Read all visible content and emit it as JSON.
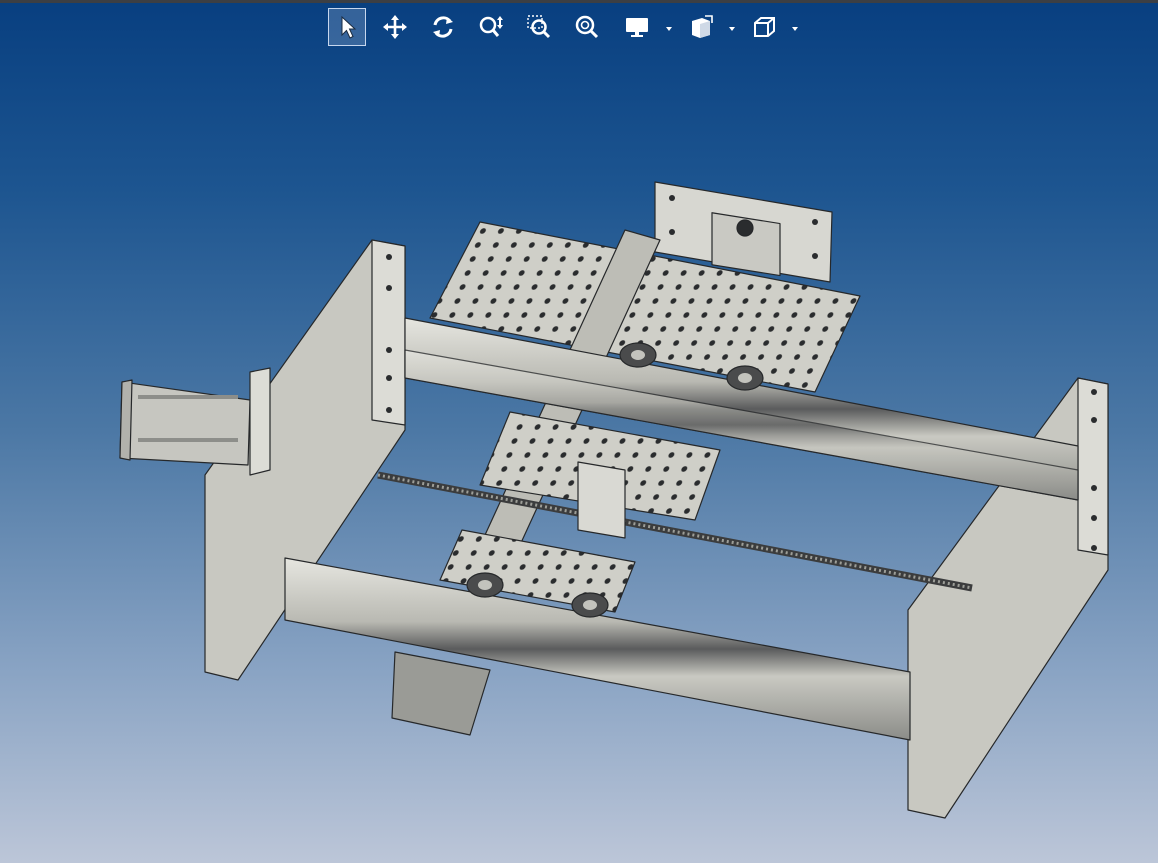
{
  "toolbar": {
    "buttons": [
      {
        "icon": "select-arrow-icon",
        "active": true
      },
      {
        "icon": "pan-arrows-icon",
        "active": false
      },
      {
        "icon": "rotate-icon",
        "active": false
      },
      {
        "icon": "zoom-interactive-icon",
        "active": false
      },
      {
        "icon": "zoom-window-icon",
        "active": false
      },
      {
        "icon": "zoom-fit-icon",
        "active": false
      },
      {
        "icon": "display-monitor-icon",
        "active": false,
        "dropdown": true
      },
      {
        "icon": "section-view-icon",
        "active": false,
        "dropdown": true
      },
      {
        "icon": "view-cube-icon",
        "active": false,
        "dropdown": true
      }
    ]
  },
  "viewport": {
    "model": "cnc-gantry-frame-assembly",
    "background_top": "#083f80",
    "background_bottom": "#bcc6d8",
    "part_color": "#d7d7d1",
    "edge_color": "#26282a"
  }
}
